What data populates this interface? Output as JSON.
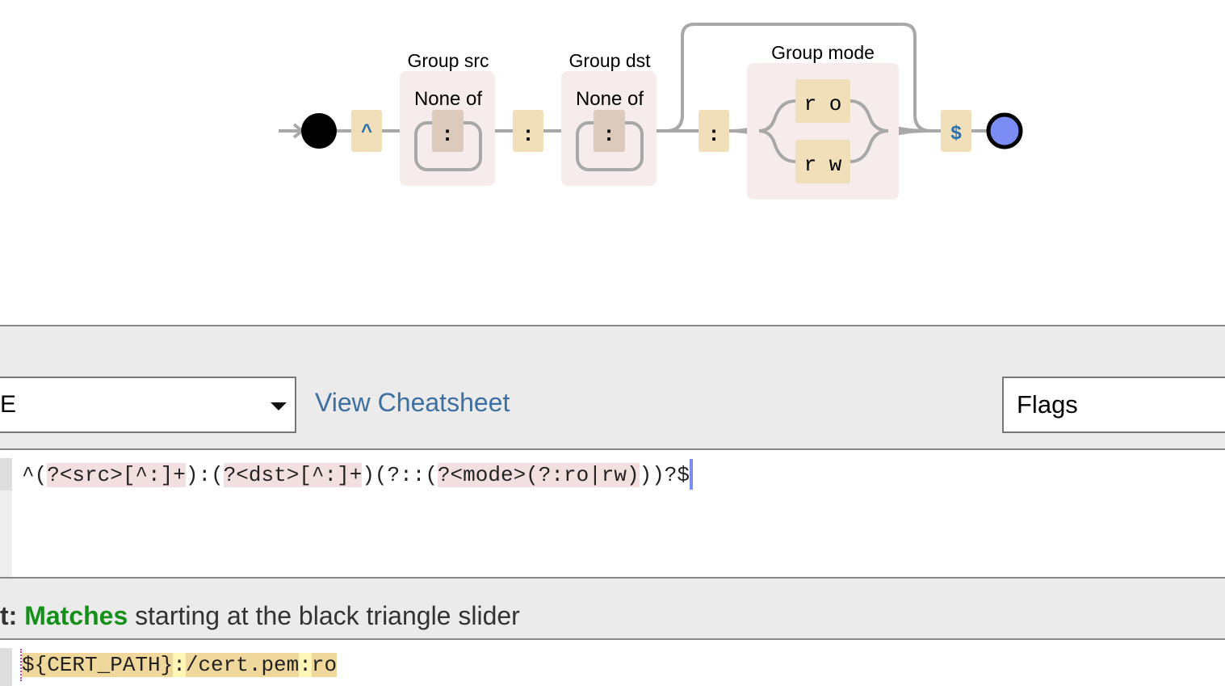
{
  "diagram": {
    "start": "start-point",
    "end": "end-point",
    "anchor_start": "^",
    "anchor_end": "$",
    "groups": [
      {
        "label": "Group src",
        "inner_label": "None of",
        "char": ":"
      },
      {
        "label": "Group dst",
        "inner_label": "None of",
        "char": ":"
      },
      {
        "label": "Group mode",
        "alternatives": [
          "r o",
          "r w"
        ]
      }
    ],
    "separator": ":",
    "colors": {
      "literal": "#f0dfb9",
      "group_bg": "#f7ecec",
      "set_char": "#dccbbc",
      "line": "#a8a8a8",
      "end_fill": "#7b8cf5",
      "anchor_text": "#2b6fb0"
    }
  },
  "toolbar": {
    "flavor_value": "E",
    "cheatsheet_label": "View Cheatsheet",
    "flags_label": "Flags"
  },
  "regex": {
    "tokens": [
      "^(",
      "?<src>[^:]+",
      ")",
      ":(",
      "?<dst>[^:]+",
      ")(?::(",
      "?<mode>(?:ro|rw)",
      "))?$"
    ]
  },
  "status": {
    "prefix": "t: ",
    "matches": "Matches",
    "rest": " starting at the black triangle slider"
  },
  "test": {
    "segments": [
      "${CERT_PATH}",
      ":",
      "/cert.pem",
      ":",
      "ro"
    ]
  }
}
